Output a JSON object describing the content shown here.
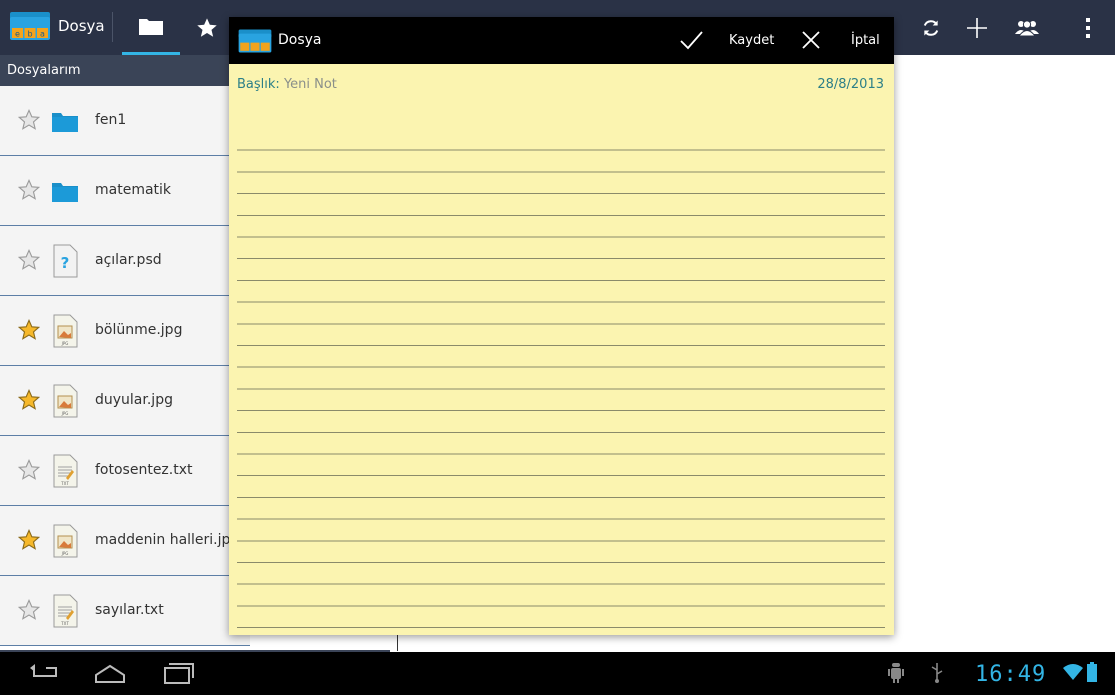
{
  "app": {
    "title": "Dosya",
    "logo_text": "eba"
  },
  "action_bar": {
    "tabs": [
      {
        "icon": "folder-icon",
        "active": true
      },
      {
        "icon": "star-icon",
        "active": false
      }
    ],
    "right_icons": [
      "refresh-icon",
      "add-icon",
      "users-icon",
      "overflow-menu-icon"
    ]
  },
  "sidebar": {
    "header": "Dosyalarım",
    "items": [
      {
        "name": "fen1",
        "type": "folder",
        "starred": false
      },
      {
        "name": "matematik",
        "type": "folder",
        "starred": false
      },
      {
        "name": "açılar.psd",
        "type": "unknown",
        "starred": false
      },
      {
        "name": "bölünme.jpg",
        "type": "jpg",
        "starred": true
      },
      {
        "name": "duyular.jpg",
        "type": "jpg",
        "starred": true
      },
      {
        "name": "fotosentez.txt",
        "type": "txt",
        "starred": false
      },
      {
        "name": "maddenin halleri.jp",
        "type": "jpg",
        "starred": true
      },
      {
        "name": "sayılar.txt",
        "type": "txt",
        "starred": false
      }
    ]
  },
  "dialog": {
    "title": "Dosya",
    "save_label": "Kaydet",
    "cancel_label": "İptal",
    "note_title_label": "Başlık:",
    "note_title_value": "Yeni Not",
    "note_date": "28/8/2013"
  },
  "status_bar": {
    "time": "16:49",
    "icons": [
      "android-debug-icon",
      "usb-icon",
      "wifi-icon",
      "battery-icon"
    ]
  },
  "colors": {
    "accent": "#33b5e5",
    "note_bg": "#fbf4b0",
    "bar_bg": "#2a3246",
    "folder": "#1a8fc9"
  }
}
